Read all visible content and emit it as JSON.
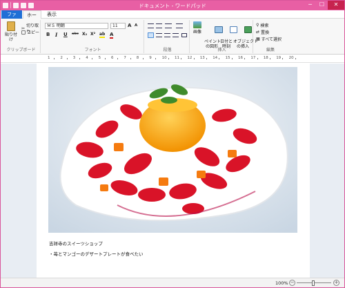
{
  "window": {
    "title": "ドキュメント - ワードパッド",
    "minimize": "─",
    "maximize": "☐",
    "close": "✕"
  },
  "tabs": {
    "file": "ファイル",
    "home": "ホーム",
    "view": "表示"
  },
  "clipboard": {
    "paste": "貼り付け",
    "cut": "切り取り",
    "copy": "コピー",
    "group_label": "クリップボード"
  },
  "font": {
    "family": "ＭＳ 明朝",
    "size": "11",
    "grow": "A",
    "shrink": "A",
    "bold": "B",
    "italic": "I",
    "underline": "U",
    "strike": "abc",
    "subscript": "X₂",
    "superscript": "X²",
    "highlight": "ab",
    "color": "A",
    "group_label": "フォント"
  },
  "paragraph": {
    "group_label": "段落"
  },
  "insert": {
    "picture": "画像",
    "paint": "ペイント\nの図形",
    "datetime": "日付と\n時刻",
    "object": "オブジェクト\nの挿入",
    "group_label": "挿入"
  },
  "edit": {
    "find": "検索",
    "replace": "置換",
    "select_all": "すべて選択",
    "group_label": "編集"
  },
  "ruler": {
    "marks": [
      "1",
      "2",
      "3",
      "4",
      "5",
      "6",
      "7",
      "8",
      "9",
      "10",
      "11",
      "12",
      "13",
      "14",
      "15",
      "16",
      "17",
      "18",
      "19",
      "20"
    ]
  },
  "document": {
    "line1": "吉祥寺のスイーツショップ",
    "line2": "・苺とマンゴーのデザートプレートが食べたい"
  },
  "status": {
    "zoom": "100%",
    "zoom_out": "−",
    "zoom_in": "+"
  },
  "colors": {
    "title_bar": "#e85fa4",
    "file_tab": "#1f6fd6",
    "close": "#c7234f"
  }
}
